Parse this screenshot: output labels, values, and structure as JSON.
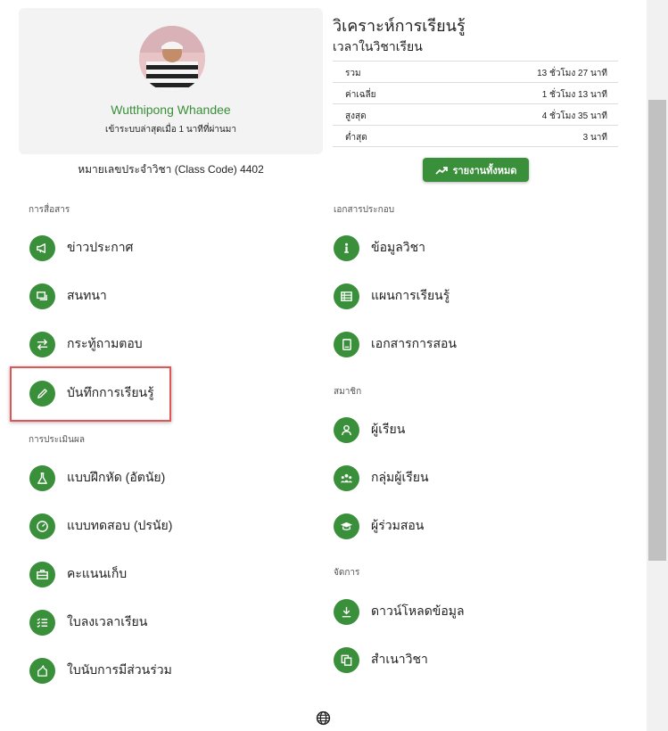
{
  "profile": {
    "name": "Wutthipong Whandee",
    "last_login": "เข้าระบบล่าสุดเมื่อ 1 นาทีที่ผ่านมา",
    "class_code": "หมายเลขประจำวิชา (Class Code) 4402"
  },
  "analytics": {
    "title": "วิเคราะห์การเรียนรู้",
    "subtitle": "เวลาในวิชาเรียน",
    "rows": [
      {
        "label": "รวม",
        "value": "13 ชั่วโมง 27 นาที"
      },
      {
        "label": "ค่าเฉลี่ย",
        "value": "1 ชั่วโมง 13 นาที"
      },
      {
        "label": "สูงสุด",
        "value": "4 ชั่วโมง 35 นาที"
      },
      {
        "label": "ต่ำสุด",
        "value": "3 นาที"
      }
    ],
    "report_button": "รายงานทั้งหมด"
  },
  "sections": {
    "communication": {
      "heading": "การสื่อสาร",
      "items": [
        "ข่าวประกาศ",
        "สนทนา",
        "กระทู้ถามตอบ",
        "บันทึกการเรียนรู้"
      ]
    },
    "assessment": {
      "heading": "การประเมินผล",
      "items": [
        "แบบฝึกหัด (อัตนัย)",
        "แบบทดสอบ (ปรนัย)",
        "คะแนนเก็บ",
        "ใบลงเวลาเรียน",
        "ใบนับการมีส่วนร่วม"
      ]
    },
    "documents": {
      "heading": "เอกสารประกอบ",
      "items": [
        "ข้อมูลวิชา",
        "แผนการเรียนรู้",
        "เอกสารการสอน"
      ]
    },
    "members": {
      "heading": "สมาชิก",
      "items": [
        "ผู้เรียน",
        "กลุ่มผู้เรียน",
        "ผู้ร่วมสอน"
      ]
    },
    "manage": {
      "heading": "จัดการ",
      "items": [
        "ดาวน์โหลดข้อมูล",
        "สำเนาวิชา"
      ]
    }
  },
  "colors": {
    "accent": "#3a8f3a",
    "name_text": "#3b8f3b",
    "highlight": "#e05555"
  }
}
